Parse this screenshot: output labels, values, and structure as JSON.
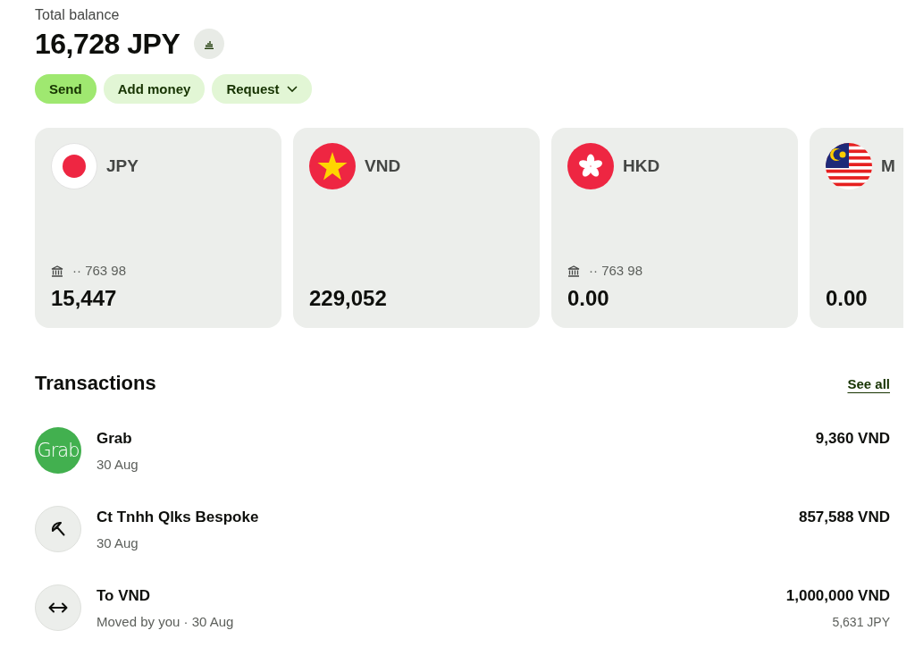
{
  "balance": {
    "label": "Total balance",
    "amount": "16,728 JPY"
  },
  "actions": [
    {
      "label": "Send",
      "kind": "primary"
    },
    {
      "label": "Add money",
      "kind": "secondary"
    },
    {
      "label": "Request",
      "kind": "dropdown"
    }
  ],
  "accounts": [
    {
      "kind": "japan",
      "currency": "JPY",
      "bank": "·· 763 98",
      "amount": "15,447"
    },
    {
      "kind": "vietnam",
      "currency": "VND",
      "amount": "229,052"
    },
    {
      "kind": "hongkong",
      "currency": "HKD",
      "bank": "·· 763 98",
      "amount": "0.00"
    },
    {
      "kind": "malaysia",
      "currency": "M",
      "amount": "0.00"
    }
  ],
  "transactions": {
    "title": "Transactions",
    "link": "See all",
    "rows": [
      {
        "kind": "logo",
        "logo_text": "Grab",
        "name": "Grab",
        "detail": "30 Aug",
        "amount": "9,360 VND"
      },
      {
        "kind": "umbrella",
        "name": "Ct Tnhh Qlks Bespoke",
        "detail": "30 Aug",
        "amount": "857,588 VND"
      },
      {
        "kind": "exchange",
        "name": "To VND",
        "detail": "Moved by you · 30 Aug",
        "amount": "1,000,000 VND",
        "sub_amount": "5,631 JPY"
      }
    ]
  }
}
